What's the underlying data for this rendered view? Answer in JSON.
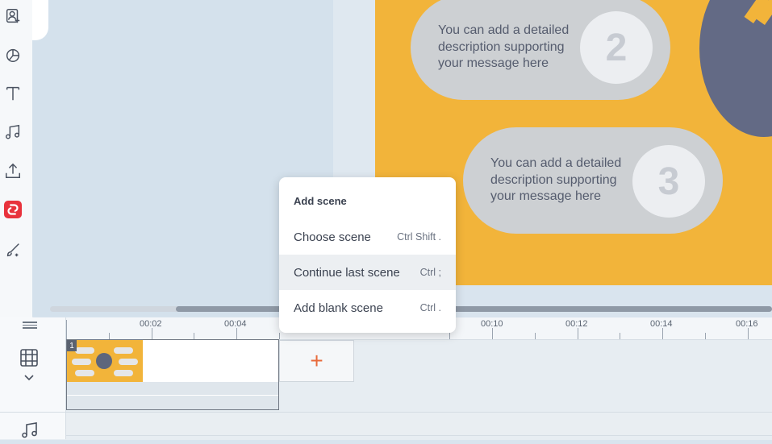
{
  "slide": {
    "pills": [
      {
        "text": "You can add a detailed description supporting your message here",
        "number": "2"
      },
      {
        "text": "You can add a detailed description supporting your message here",
        "number": "3"
      }
    ]
  },
  "timeline": {
    "ruler_labels": [
      "00:02",
      "00:04",
      "00:10",
      "00:12",
      "00:14",
      "00:16"
    ],
    "scene_number": "1",
    "add_scene_symbol": "+"
  },
  "menu": {
    "title": "Add scene",
    "items": [
      {
        "label": "Choose scene",
        "shortcut": "Ctrl Shift ."
      },
      {
        "label": "Continue last scene",
        "shortcut": "Ctrl ;"
      },
      {
        "label": "Add blank scene",
        "shortcut": "Ctrl ."
      }
    ]
  },
  "colors": {
    "slide_background": "#f2b43a",
    "accent_red": "#e8323c",
    "add_scene_plus": "#e86a3a"
  },
  "icons": [
    "character-icon",
    "chart-icon",
    "text-icon",
    "music-icon",
    "upload-icon",
    "brand-icon",
    "draw-icon",
    "scene-grid-icon",
    "chevron-down-icon",
    "audio-track-icon",
    "drag-handle-icon"
  ]
}
